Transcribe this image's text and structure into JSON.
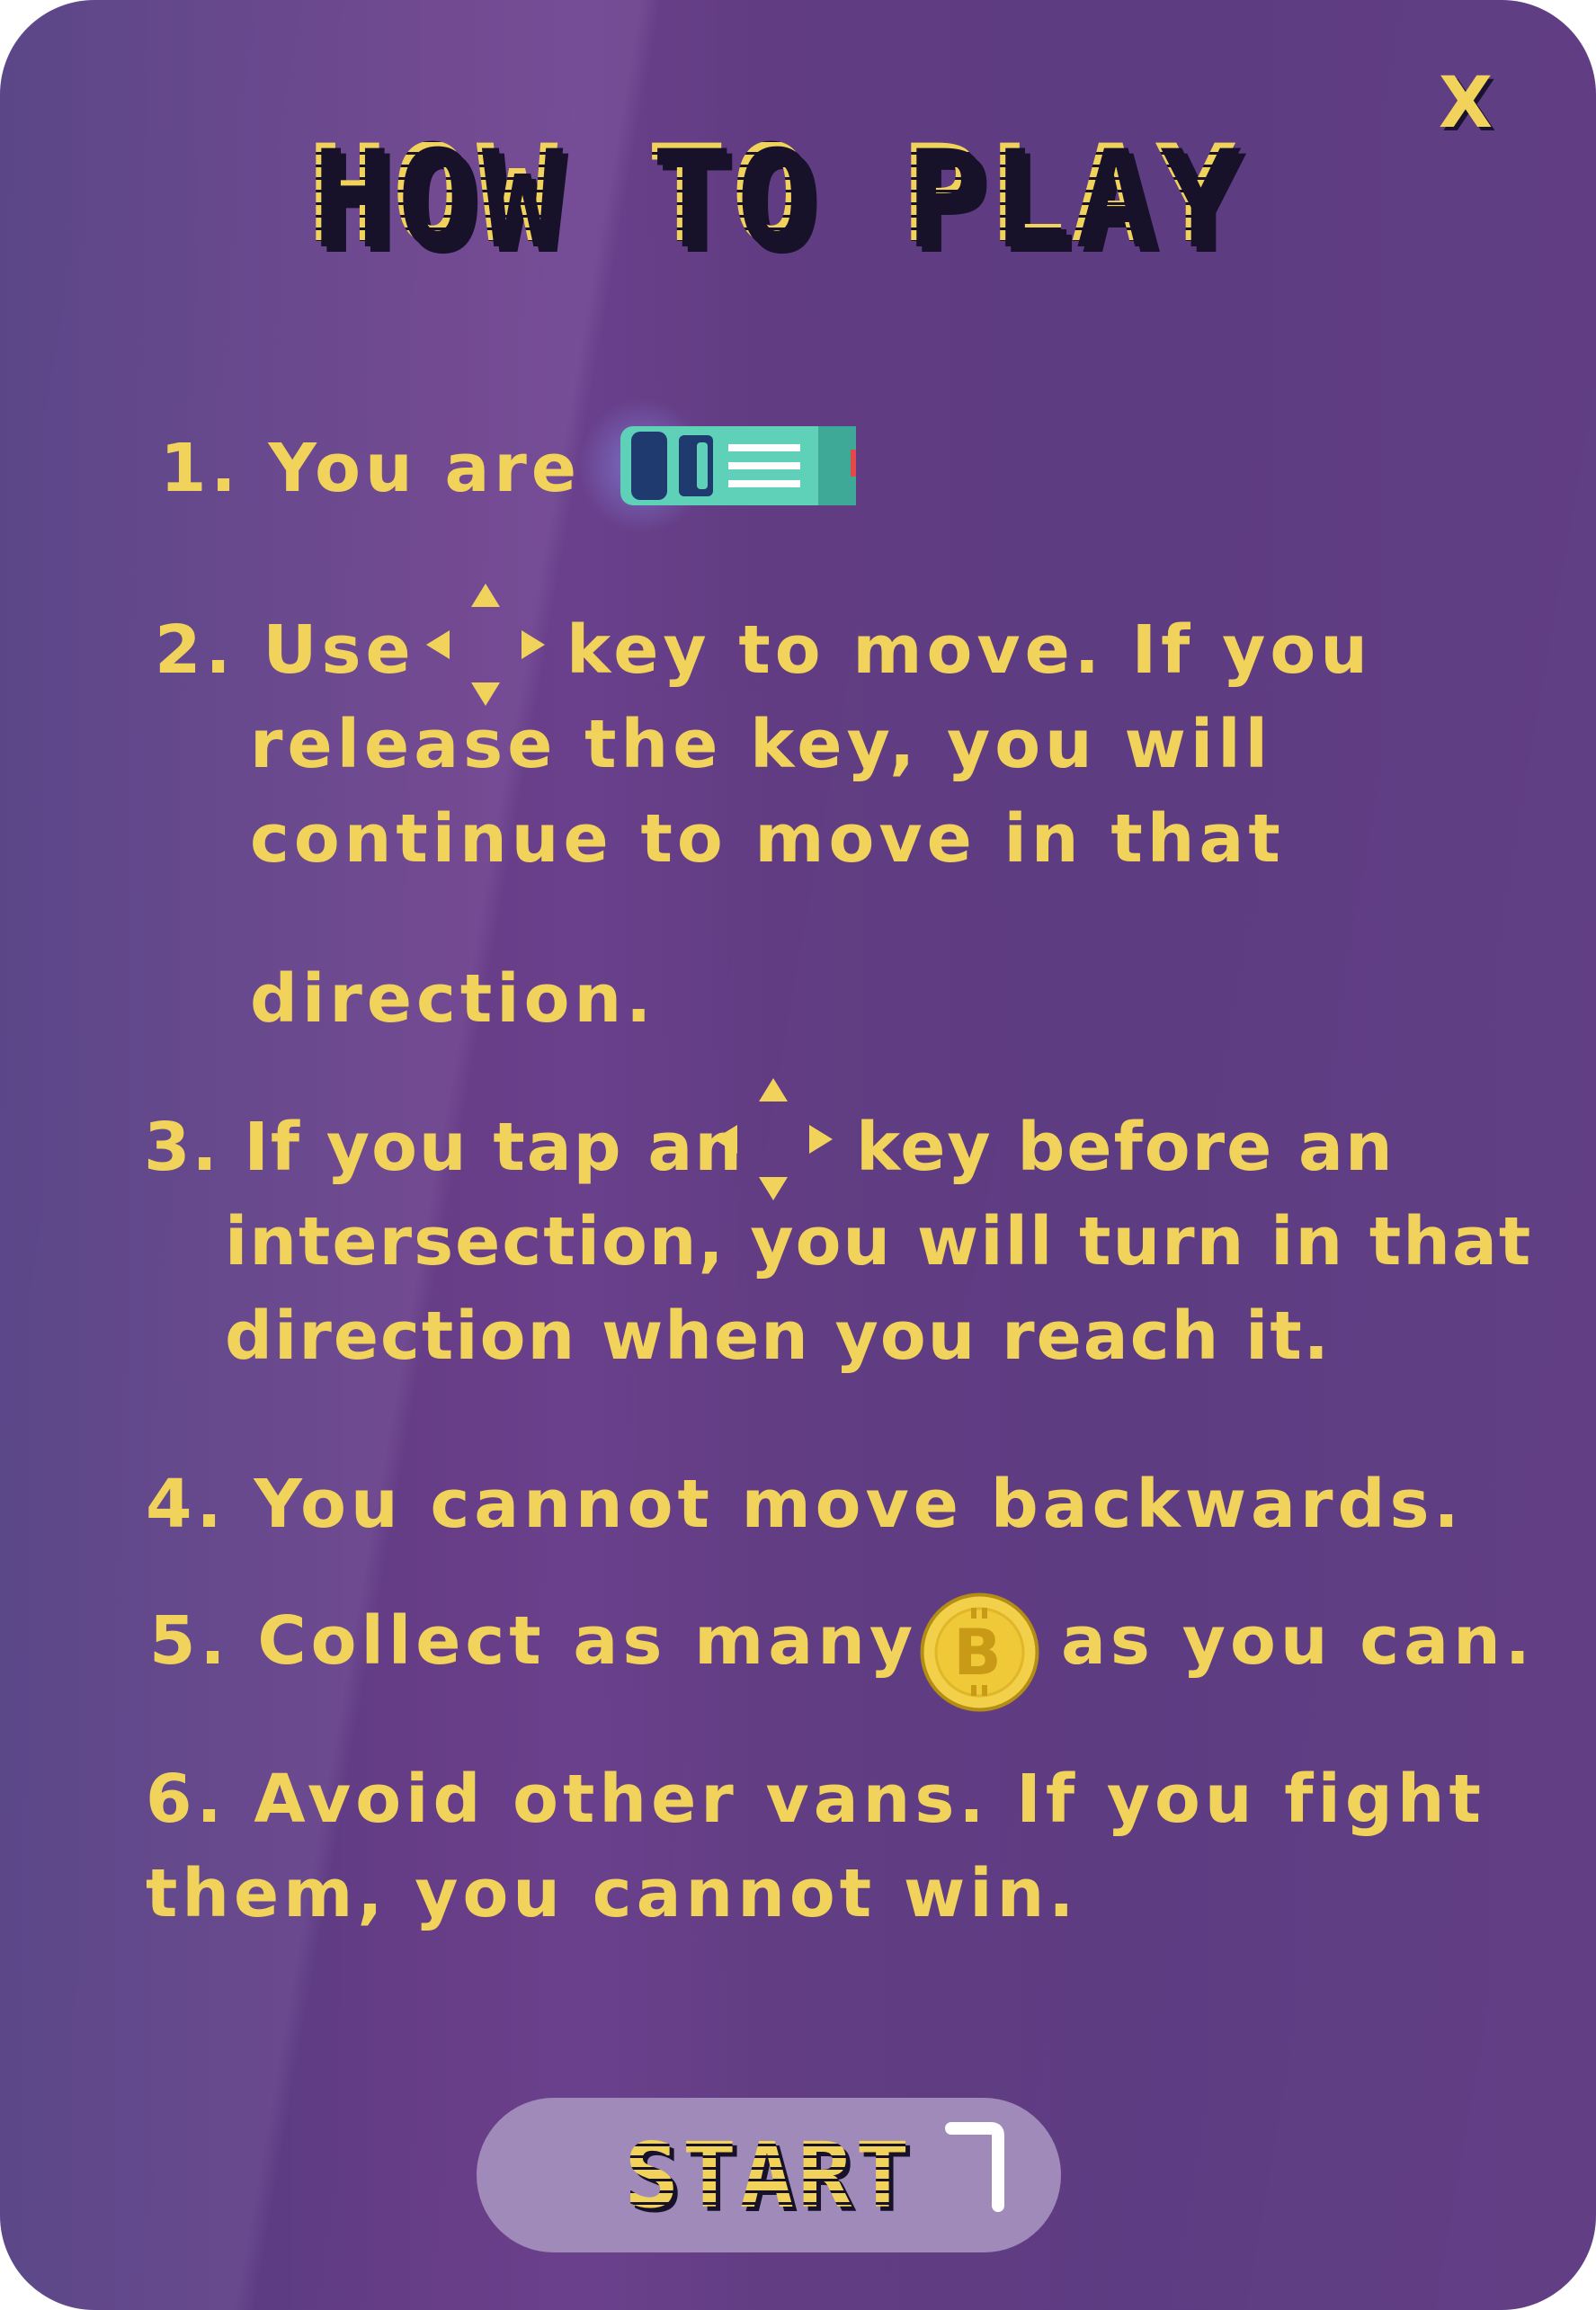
{
  "dialog": {
    "close_label": "X",
    "title": "HOW TO PLAY"
  },
  "rules": [
    {
      "lines": [
        "1. You are"
      ],
      "icon": "player-van-icon"
    },
    {
      "lines": [
        "2. Use",
        "key to move. If you",
        "release the key, you will",
        "continue to move in that",
        "direction."
      ],
      "icon": "arrow-keys-icon"
    },
    {
      "lines": [
        "3. If you tap an",
        "key before an",
        "intersection, you will turn in that",
        "direction when you reach it."
      ],
      "icon": "arrow-keys-icon"
    },
    {
      "lines": [
        "4. You cannot move backwards."
      ]
    },
    {
      "lines": [
        "5. Collect as many",
        "as you can."
      ],
      "icon": "bitcoin-coin-icon"
    },
    {
      "lines": [
        "6. Avoid other vans. If you fight",
        "them, you cannot win."
      ]
    }
  ],
  "start_button": {
    "label": "START"
  },
  "colors": {
    "text": "#f1d35c",
    "panel": "#623f85",
    "button": "#a08ab9",
    "van": "#5ed1b8"
  }
}
